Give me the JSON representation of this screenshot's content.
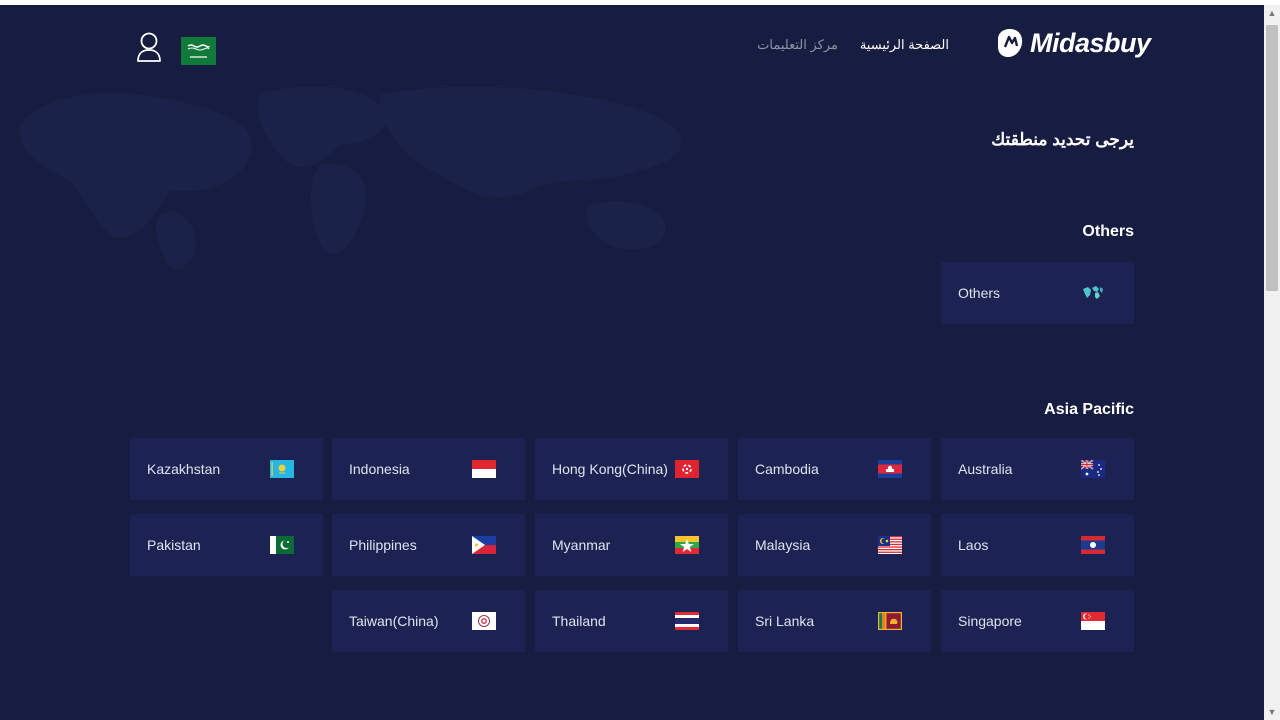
{
  "header": {
    "logo_text": "Midasbuy",
    "nav_home": "الصفحة الرئيسية",
    "nav_help": "مركز التعليمات"
  },
  "page_title": "يرجى تحديد منطقتك",
  "sections": {
    "others": {
      "title": "Others",
      "items": [
        {
          "label": "Others",
          "icon": "world-map-icon"
        }
      ]
    },
    "asia_pacific": {
      "title": "Asia Pacific",
      "items": [
        {
          "label": "Kazakhstan",
          "icon": "flag-kazakhstan-icon"
        },
        {
          "label": "Indonesia",
          "icon": "flag-indonesia-icon"
        },
        {
          "label": "Hong Kong(China)",
          "icon": "flag-hong-kong-icon"
        },
        {
          "label": "Cambodia",
          "icon": "flag-cambodia-icon"
        },
        {
          "label": "Australia",
          "icon": "flag-australia-icon"
        },
        {
          "label": "Pakistan",
          "icon": "flag-pakistan-icon"
        },
        {
          "label": "Philippines",
          "icon": "flag-philippines-icon"
        },
        {
          "label": "Myanmar",
          "icon": "flag-myanmar-icon"
        },
        {
          "label": "Malaysia",
          "icon": "flag-malaysia-icon"
        },
        {
          "label": "Laos",
          "icon": "flag-laos-icon"
        },
        {
          "label": "Taiwan(China)",
          "icon": "flag-taiwan-icon"
        },
        {
          "label": "Thailand",
          "icon": "flag-thailand-icon"
        },
        {
          "label": "Sri Lanka",
          "icon": "flag-sri-lanka-icon"
        },
        {
          "label": "Singapore",
          "icon": "flag-singapore-icon"
        }
      ]
    }
  },
  "colors": {
    "background": "#161d40",
    "card": "#1c2352",
    "text": "#ffffff",
    "muted_text": "#8e93a8"
  }
}
